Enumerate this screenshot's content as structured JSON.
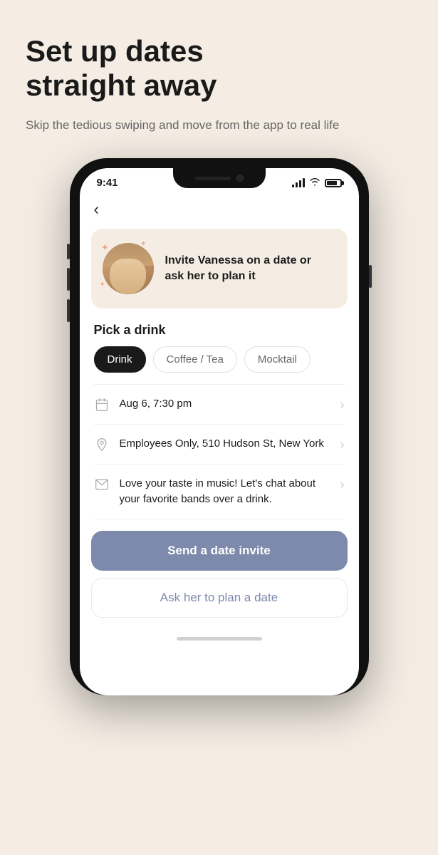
{
  "header": {
    "title_line1": "Set up dates",
    "title_line2": "straight away",
    "subtitle": "Skip the tedious swiping and move from the app to real life"
  },
  "phone": {
    "status_bar": {
      "time": "9:41"
    },
    "profile_card": {
      "invite_text": "Invite Vanessa on a date or ask her to plan it"
    },
    "drink_section": {
      "title": "Pick a drink",
      "options": [
        {
          "label": "Drink",
          "active": true
        },
        {
          "label": "Coffee / Tea",
          "active": false
        },
        {
          "label": "Mocktail",
          "active": false
        }
      ]
    },
    "list_items": [
      {
        "icon": "calendar",
        "text": "Aug 6, 7:30 pm",
        "has_chevron": true
      },
      {
        "icon": "location",
        "text": "Employees Only, 510 Hudson St, New York",
        "has_chevron": true
      },
      {
        "icon": "message",
        "text": "Love your taste in music! Let's chat about your favorite bands over a drink.",
        "has_chevron": true
      }
    ],
    "buttons": {
      "primary": "Send a date invite",
      "secondary": "Ask her to plan a date"
    }
  }
}
